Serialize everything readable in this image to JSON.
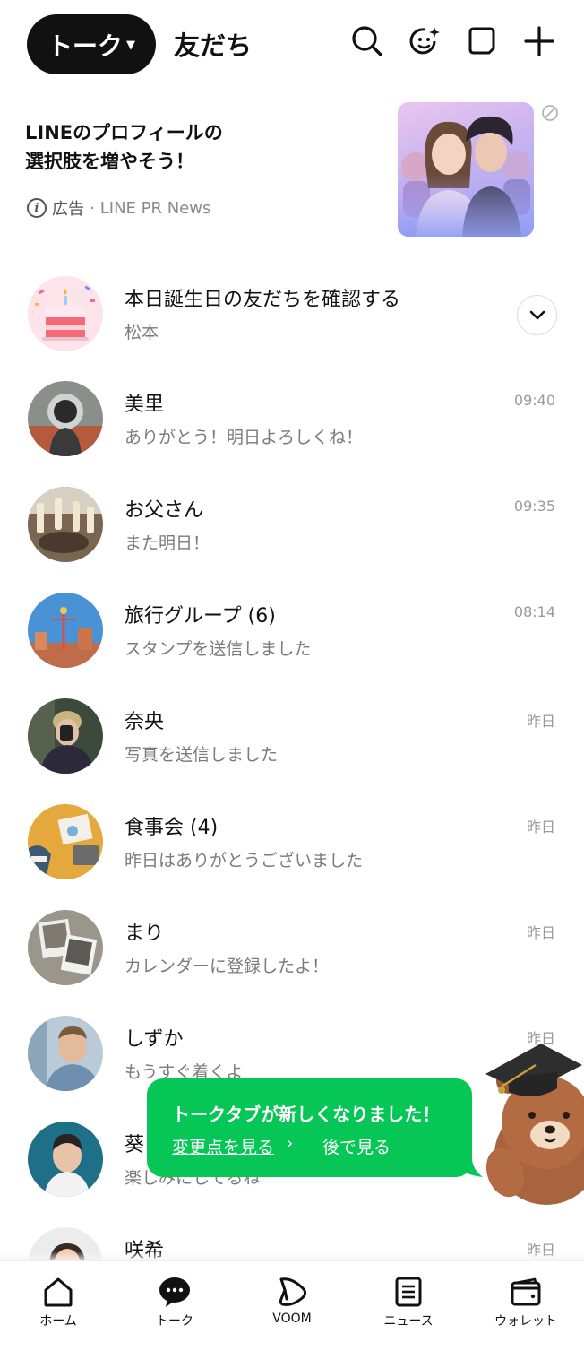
{
  "header": {
    "active_tab": "トーク",
    "other_tab": "友だち"
  },
  "ad": {
    "title_line1": "LINEのプロフィールの",
    "title_line2": "選択肢を増やそう！",
    "ad_label": "広告",
    "separator": "·",
    "source": "LINE PR News"
  },
  "birthday": {
    "title": "本日誕生日の友だちを確認する",
    "subtitle": "松本"
  },
  "chats": [
    {
      "name": "美里",
      "message": "ありがとう！明日よろしくね！",
      "time": "09:40",
      "avatar_color": "#7d7066"
    },
    {
      "name": "お父さん",
      "message": "また明日！",
      "time": "09:35",
      "avatar_color": "#6b5a46"
    },
    {
      "name": "旅行グループ (6)",
      "message": "スタンプを送信しました",
      "time": "08:14",
      "avatar_color": "#4b8fd0"
    },
    {
      "name": "奈央",
      "message": "写真を送信しました",
      "time": "昨日",
      "avatar_color": "#2e3a2f"
    },
    {
      "name": "食事会 (4)",
      "message": "昨日はありがとうございました",
      "time": "昨日",
      "avatar_color": "#e0a23a"
    },
    {
      "name": "まり",
      "message": "カレンダーに登録したよ！",
      "time": "昨日",
      "avatar_color": "#8c8a84"
    },
    {
      "name": "しずか",
      "message": "もうすぐ着くよ",
      "time": "昨日",
      "avatar_color": "#a9c0d3"
    },
    {
      "name": "葵",
      "message": "楽しみにしてるね",
      "time": "",
      "avatar_color": "#1f6e86"
    },
    {
      "name": "咲希",
      "message": "",
      "time": "昨日",
      "avatar_color": "#e8a08a"
    }
  ],
  "tooltip": {
    "title": "トークタブが新しくなりました！",
    "link": "変更点を見る",
    "later": "後で見る",
    "bg_color": "#06c755"
  },
  "nav": [
    {
      "label": "ホーム",
      "icon": "home-icon"
    },
    {
      "label": "トーク",
      "icon": "chat-icon"
    },
    {
      "label": "VOOM",
      "icon": "voom-icon"
    },
    {
      "label": "ニュース",
      "icon": "news-icon"
    },
    {
      "label": "ウォレット",
      "icon": "wallet-icon"
    }
  ]
}
